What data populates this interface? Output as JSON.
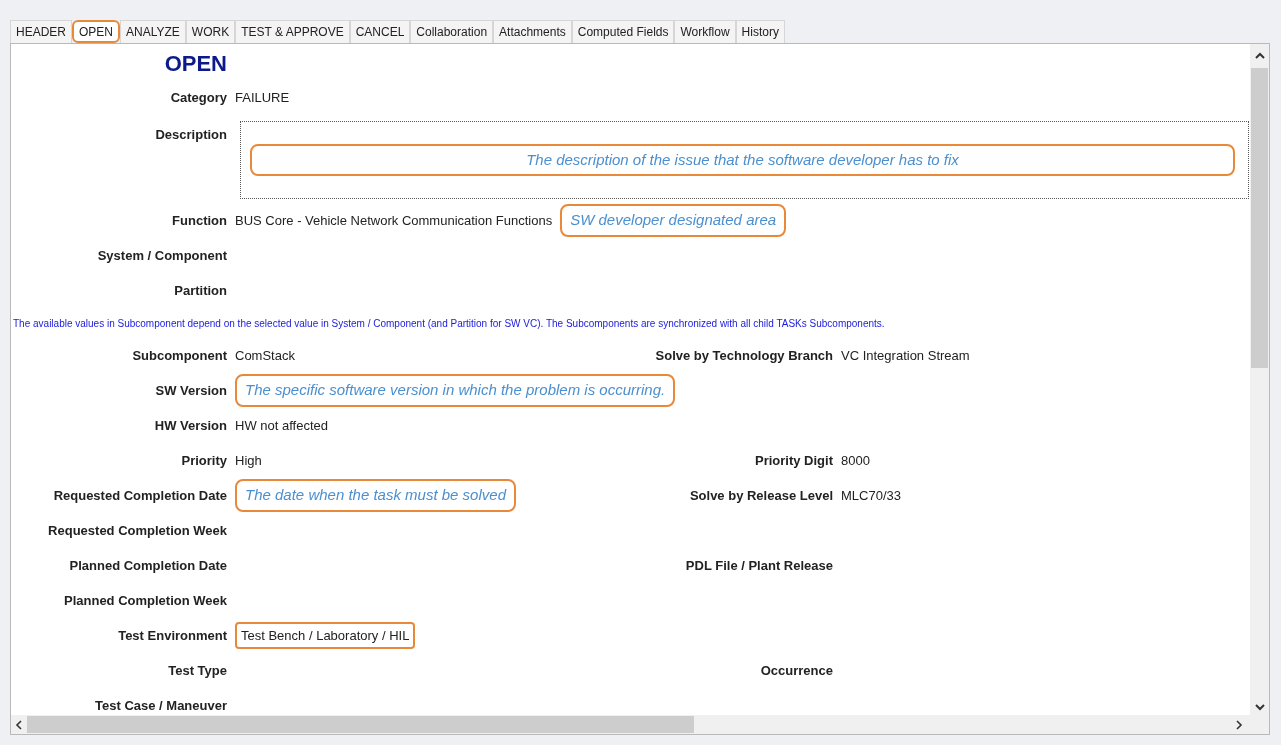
{
  "tabs": [
    {
      "label": "HEADER",
      "selected": false
    },
    {
      "label": "OPEN",
      "selected": true
    },
    {
      "label": "ANALYZE",
      "selected": false
    },
    {
      "label": "WORK",
      "selected": false
    },
    {
      "label": "TEST & APPROVE",
      "selected": false
    },
    {
      "label": "CANCEL",
      "selected": false
    },
    {
      "label": "Collaboration",
      "selected": false
    },
    {
      "label": "Attachments",
      "selected": false
    },
    {
      "label": "Computed Fields",
      "selected": false
    },
    {
      "label": "Workflow",
      "selected": false
    },
    {
      "label": "History",
      "selected": false
    }
  ],
  "form": {
    "heading": "OPEN",
    "rows": [
      {
        "kind": "field",
        "left": {
          "label": "Category",
          "value": "FAILURE"
        }
      },
      {
        "kind": "description",
        "left": {
          "label": "Description",
          "annotation": "The description of the issue that the software developer has to fix"
        }
      },
      {
        "kind": "field",
        "left": {
          "label": "Function",
          "value": "BUS Core - Vehicle Network Communication Functions",
          "annotation": "SW developer designated area"
        }
      },
      {
        "kind": "field",
        "left": {
          "label": "System / Component"
        }
      },
      {
        "kind": "field",
        "left": {
          "label": "Partition"
        }
      },
      {
        "kind": "note",
        "text": "The available values in Subcomponent depend on the selected value in System / Component (and Partition for SW VC). The Subcomponents are synchronized with all child TASKs Subcomponents."
      },
      {
        "kind": "field",
        "left": {
          "label": "Subcomponent",
          "value": "ComStack"
        },
        "right": {
          "label": "Solve by Technology Branch",
          "value": "VC Integration Stream"
        }
      },
      {
        "kind": "field",
        "left": {
          "label": "SW Version",
          "annotation": "The specific software version in which the problem is occurring."
        }
      },
      {
        "kind": "field",
        "left": {
          "label": "HW Version",
          "value": "HW not affected"
        }
      },
      {
        "kind": "field",
        "left": {
          "label": "Priority",
          "value": "High"
        },
        "right": {
          "label": "Priority Digit",
          "value": "8000"
        }
      },
      {
        "kind": "field",
        "left": {
          "label": "Requested Completion Date",
          "annotation": "The date when the task must be solved"
        },
        "right": {
          "label": "Solve by Release Level",
          "value": "MLC70/33"
        }
      },
      {
        "kind": "field",
        "left": {
          "label": "Requested Completion Week"
        }
      },
      {
        "kind": "field",
        "left": {
          "label": "Planned Completion Date"
        },
        "right": {
          "label": "PDL File / Plant Release"
        }
      },
      {
        "kind": "field",
        "left": {
          "label": "Planned Completion Week"
        }
      },
      {
        "kind": "field",
        "left": {
          "label": "Test Environment",
          "value": "Test Bench / Laboratory / HIL",
          "highlighted": true
        }
      },
      {
        "kind": "field",
        "left": {
          "label": "Test Type"
        },
        "right": {
          "label": "Occurrence"
        }
      },
      {
        "kind": "field",
        "left": {
          "label": "Test Case / Maneuver"
        }
      }
    ]
  }
}
